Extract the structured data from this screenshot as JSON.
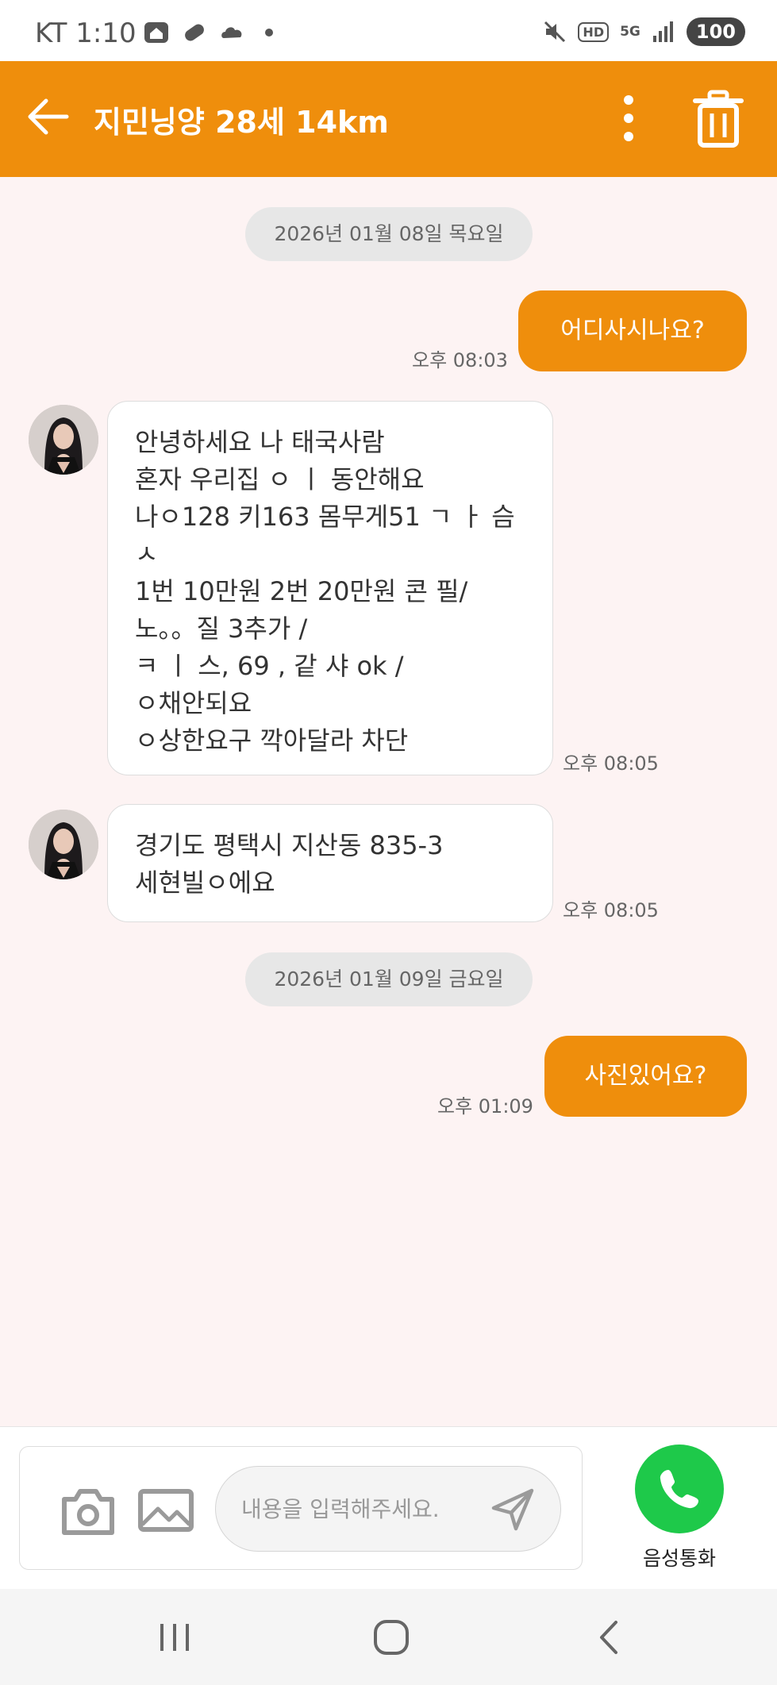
{
  "status_bar": {
    "carrier_time": "KT 1:10",
    "network": "5G",
    "hd": "HD",
    "battery": "100"
  },
  "header": {
    "title": "지민닝양 28세 14km",
    "accent_color": "#ef8e0c"
  },
  "messages": [
    {
      "type": "date",
      "text": "2026년 01월 08일 목요일"
    },
    {
      "type": "outgoing",
      "text": "어디사시나요?",
      "time": "오후 08:03"
    },
    {
      "type": "incoming",
      "lines": [
        "안녕하세요 나 태국사람",
        "혼자 우리집 ㅇ ㅣ 동안해요",
        "나ㅇ128 키163 몸무게51 ㄱ ㅏ 슴",
        "ㅅ",
        "1번 10만원 2번 20만원 콘 필/",
        "노。。질 3추가 /",
        "ㅋ ㅣ 스, 69 , 같 샤 ok /",
        "ㅇ채안되요",
        "ㅇ상한요구 깍아달라 차단"
      ],
      "time": "오후 08:05"
    },
    {
      "type": "incoming",
      "lines": [
        "경기도 평택시 지산동 835-3",
        "세현빌ㅇ에요"
      ],
      "time": "오후 08:05"
    },
    {
      "type": "date",
      "text": "2026년 01월 09일 금요일"
    },
    {
      "type": "outgoing",
      "text": "사진있어요?",
      "time": "오후 01:09"
    }
  ],
  "composer": {
    "placeholder": "내용을 입력해주세요.",
    "value": ""
  },
  "call": {
    "label": "음성통화",
    "color": "#1ec94a"
  },
  "icons": [
    "back-arrow-icon",
    "more-vertical-icon",
    "trash-icon",
    "camera-icon",
    "gallery-icon",
    "send-icon",
    "phone-icon",
    "recent-apps-icon",
    "home-icon",
    "nav-back-icon"
  ]
}
